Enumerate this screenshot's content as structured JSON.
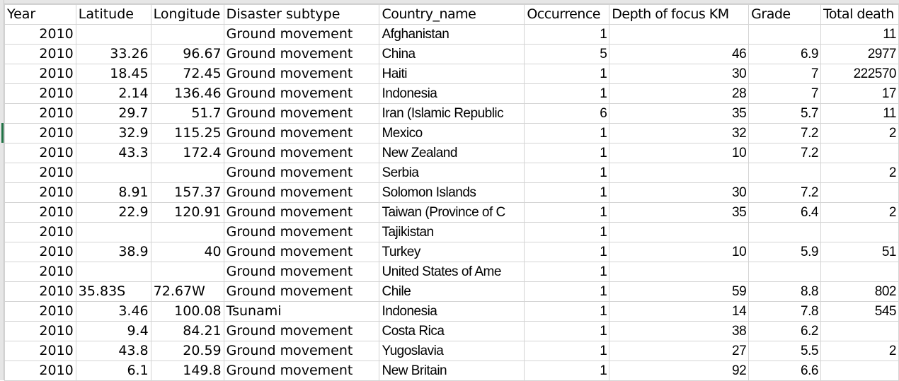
{
  "sheet": {
    "columns": [
      {
        "key": "year",
        "label": "Year",
        "align": "right"
      },
      {
        "key": "latitude",
        "label": "Latitude",
        "align": "right"
      },
      {
        "key": "longitude",
        "label": "Longitude",
        "align": "right"
      },
      {
        "key": "subtype",
        "label": "Disaster subtype",
        "align": "left"
      },
      {
        "key": "country",
        "label": "Country_name",
        "align": "left"
      },
      {
        "key": "occurrence",
        "label": "Occurrence",
        "align": "right"
      },
      {
        "key": "depth",
        "label": "Depth of focus KM",
        "align": "right"
      },
      {
        "key": "grade",
        "label": "Grade",
        "align": "right"
      },
      {
        "key": "deaths",
        "label": "Total death",
        "align": "right"
      }
    ],
    "rows": [
      [
        "2010",
        "",
        "",
        "Ground movement",
        "Afghanistan",
        "1",
        "",
        "",
        "11"
      ],
      [
        "2010",
        "33.26",
        "96.67",
        "Ground movement",
        "China",
        "5",
        "46",
        "6.9",
        "2977"
      ],
      [
        "2010",
        "18.45",
        "72.45",
        "Ground movement",
        "Haiti",
        "1",
        "30",
        "7",
        "222570"
      ],
      [
        "2010",
        "2.14",
        "136.46",
        "Ground movement",
        "Indonesia",
        "1",
        "28",
        "7",
        "17"
      ],
      [
        "2010",
        "29.7",
        "51.7",
        "Ground movement",
        "Iran (Islamic Republic",
        "6",
        "35",
        "5.7",
        "11"
      ],
      [
        "2010",
        "32.9",
        "115.25",
        "Ground movement",
        "Mexico",
        "1",
        "32",
        "7.2",
        "2"
      ],
      [
        "2010",
        "43.3",
        "172.4",
        "Ground movement",
        "New Zealand",
        "1",
        "10",
        "7.2",
        ""
      ],
      [
        "2010",
        "",
        "",
        "Ground movement",
        "Serbia",
        "1",
        "",
        "",
        "2"
      ],
      [
        "2010",
        "8.91",
        "157.37",
        "Ground movement",
        "Solomon Islands",
        "1",
        "30",
        "7.2",
        ""
      ],
      [
        "2010",
        "22.9",
        "120.91",
        "Ground movement",
        "Taiwan (Province of C",
        "1",
        "35",
        "6.4",
        "2"
      ],
      [
        "2010",
        "",
        "",
        "Ground movement",
        "Tajikistan",
        "1",
        "",
        "",
        ""
      ],
      [
        "2010",
        "38.9",
        "40",
        "Ground movement",
        "Turkey",
        "1",
        "10",
        "5.9",
        "51"
      ],
      [
        "2010",
        "",
        "",
        "Ground movement",
        "United States of Ame",
        "1",
        "",
        "",
        ""
      ],
      [
        "2010",
        "35.83S",
        "72.67W",
        "Ground movement",
        "Chile",
        "1",
        "59",
        "8.8",
        "802"
      ],
      [
        "2010",
        "3.46",
        "100.08",
        "Tsunami",
        "Indonesia",
        "1",
        "14",
        "7.8",
        "545"
      ],
      [
        "2010",
        "9.4",
        "84.21",
        "Ground movement",
        "Costa Rica",
        "1",
        "38",
        "6.2",
        ""
      ],
      [
        "2010",
        "43.8",
        "20.59",
        "Ground movement",
        "Yugoslavia",
        "1",
        "27",
        "5.5",
        "2"
      ],
      [
        "2010",
        "6.1",
        "149.8",
        "Ground movement",
        "New Britain",
        "1",
        "92",
        "6.6",
        ""
      ]
    ],
    "text_left_overrides": [
      [
        13,
        1
      ],
      [
        13,
        2
      ]
    ],
    "accent_color": "#217346"
  }
}
